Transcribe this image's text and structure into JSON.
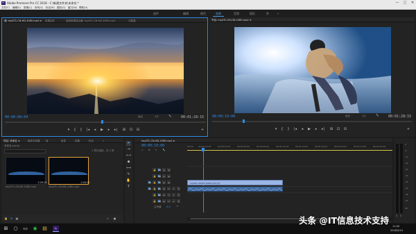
{
  "app": {
    "title": "Adobe Premiere Pro CC 2018 - C:\\新建文件夹\\未命名.*",
    "logo": "Pr"
  },
  "window_buttons": [
    "—",
    "□",
    "✕"
  ],
  "menu": [
    "文件(F)",
    "编辑(E)",
    "剪辑(C)",
    "序列(S)",
    "标记(M)",
    "图形(G)",
    "窗口(W)",
    "帮助(H)"
  ],
  "workspaces": [
    "组件",
    "编辑",
    "颜色",
    "效果",
    "音频",
    "图形",
    "库",
    "»"
  ],
  "active_workspace_index": 1,
  "source_monitor": {
    "tabs": [
      "源: mp4TC-CN-HD-1080.mp4 ≡",
      "效果控件",
      "音频剪辑混合器: mp4TC-CN-HD-1080.mp4",
      "元数据"
    ],
    "timecode_in": "00:00:08:04",
    "timecode_out": "00:01:28:15",
    "fit": "适合"
  },
  "program_monitor": {
    "tabs": [
      "节目: mp4TC-CN-HD-1080.mp4 ≡"
    ],
    "timecode_in": "00:00:10:00",
    "timecode_out": "00:01:28:15",
    "fit": "适合",
    "quality": "1/2"
  },
  "transport": [
    "▾",
    "|",
    "{",
    "}",
    "|◂",
    "◂",
    "▶",
    "▸",
    "▸|",
    "⊞",
    "⊡",
    "⊟",
    "+"
  ],
  "project_panel": {
    "tabs": [
      "项目: 未命名 ≡",
      "媒体浏览器",
      "库",
      "信息",
      "效果",
      "标记",
      "»"
    ],
    "path": "未命名.prproj",
    "search_placeholder": "",
    "count": "1 项已选择，共 2 项",
    "items": [
      {
        "name": "mp4TC-CN-HD-1080.mp4",
        "duration": "1:28:15"
      },
      {
        "name": "mp4TC-CN-HD-1080.mp4",
        "duration": "1:28:15"
      }
    ]
  },
  "timeline": {
    "tab": "mp4TC-CN-HD-1080.mp4 ≡",
    "timecode": "00:00:10:00",
    "ruler": [
      "00:00",
      "00:00:14:23",
      "00:00:29:23",
      "00:00:44:22",
      "00:00:59:22",
      "00:01:14:22",
      "00:01:29:21",
      "00:01:44:21",
      "00:01:59:21",
      "00:02:14:20",
      "00:02:29:19"
    ],
    "tracks": [
      {
        "label": "V3",
        "buttons": [
          "V3",
          "",
          "◉"
        ]
      },
      {
        "label": "V2",
        "buttons": [
          "V2",
          "",
          "◉"
        ]
      },
      {
        "label": "V1",
        "buttons": [
          "V1",
          "",
          "◉"
        ]
      },
      {
        "label": "A1",
        "buttons": [
          "A1",
          "M",
          "S"
        ]
      },
      {
        "label": "A2",
        "buttons": [
          "A2",
          "M",
          "S"
        ]
      },
      {
        "label": "A3",
        "buttons": [
          "A3",
          "M",
          "S"
        ]
      }
    ],
    "master": "主声道",
    "master_value": "0.0",
    "video_clip_label": "mp4TC-CN-HD-1080.mp4 [V]",
    "audio_clip_label": ""
  },
  "meter_labels": [
    "0",
    "-6",
    "-12",
    "-18",
    "-24",
    "-30",
    "-36",
    "-42",
    "-48",
    "-54",
    "dB"
  ],
  "meter_footer": [
    "S",
    "S"
  ],
  "taskbar": {
    "start": "⊞",
    "apps": [
      "○",
      "▭",
      "◉",
      "▤",
      "Pr"
    ],
    "tray": "",
    "time": "11:00",
    "date": "2018/5/14"
  },
  "watermark": "头条 @IT信息技术支持",
  "colors": {
    "accent": "#2d8ceb",
    "clip_video": "#9bb5e6",
    "clip_audio": "#3f6aa1",
    "playhead": "#2d8ceb",
    "in_out_bar": "#d9c84a"
  }
}
